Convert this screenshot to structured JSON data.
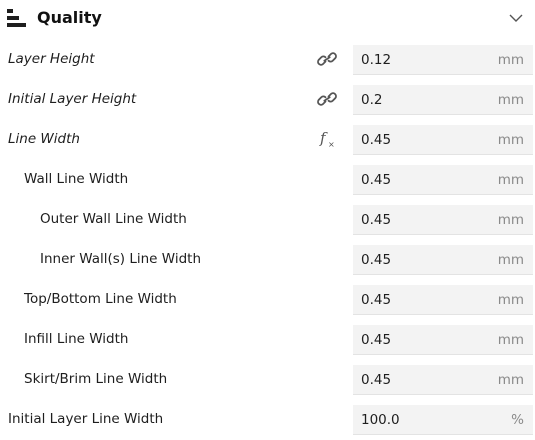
{
  "section": {
    "title": "Quality",
    "icon": "quality-bars-icon",
    "collapse_icon": "chevron-down-icon"
  },
  "settings": [
    {
      "label": "Layer Height",
      "value": "0.12",
      "unit": "mm",
      "style": "italic",
      "state_icon": "link-icon"
    },
    {
      "label": "Initial Layer Height",
      "value": "0.2",
      "unit": "mm",
      "style": "italic",
      "state_icon": "link-icon"
    },
    {
      "label": "Line Width",
      "value": "0.45",
      "unit": "mm",
      "style": "italic",
      "state_icon": "function-icon"
    },
    {
      "label": "Wall Line Width",
      "value": "0.45",
      "unit": "mm"
    },
    {
      "label": "Outer Wall Line Width",
      "value": "0.45",
      "unit": "mm"
    },
    {
      "label": "Inner Wall(s) Line Width",
      "value": "0.45",
      "unit": "mm"
    },
    {
      "label": "Top/Bottom Line Width",
      "value": "0.45",
      "unit": "mm"
    },
    {
      "label": "Infill Line Width",
      "value": "0.45",
      "unit": "mm"
    },
    {
      "label": "Skirt/Brim Line Width",
      "value": "0.45",
      "unit": "mm"
    },
    {
      "label": "Initial Layer Line Width",
      "value": "100.0",
      "unit": "%"
    }
  ]
}
